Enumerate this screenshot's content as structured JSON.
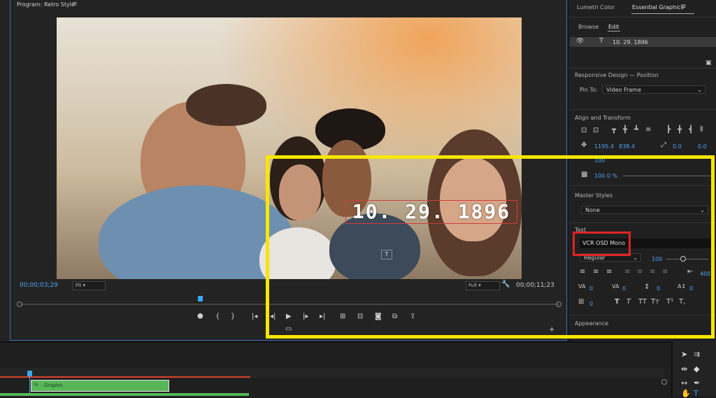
{
  "program": {
    "tab_title": "Program: Retro Style",
    "tab_menu_icon": "hamburger-menu-icon",
    "overlay_text": "10. 29. 1896",
    "timecode_current": "00;00;03;29",
    "zoom": "Fit",
    "resolution": "Full",
    "timecode_duration": "00;00;11;23",
    "playhead_position": 0.33
  },
  "right_panel": {
    "tabs": [
      "Lumetri Color",
      "Essential Graphics"
    ],
    "active_tab": "Essential Graphics",
    "tab_menu_icon": "hamburger-menu-icon",
    "subtabs": [
      "Browse",
      "Edit"
    ],
    "active_subtab": "Edit",
    "layer": {
      "name": "10. 29. 1896",
      "type_icon": "text-layer-icon",
      "visibility_icon": "eye-icon"
    },
    "responsive_design": {
      "title": "Responsive Design — Position",
      "pin_label": "Pin To:",
      "pin_value": "Video Frame"
    },
    "align_transform": {
      "title": "Align and Transform",
      "pos_x": "1195.4",
      "pos_y": "838.4",
      "rotation": "0.0",
      "anchor": "0.0",
      "scale_partial": "100",
      "opacity": "100.0 %"
    },
    "master_styles": {
      "title": "Master Styles",
      "value": "None"
    },
    "text": {
      "title": "Text",
      "font": "VCR OSD Mono",
      "style": "Regular",
      "size": "100",
      "tracking_value": "400",
      "kerning": "0",
      "tracking": "0",
      "leading": "0",
      "baseline": "0",
      "tsume": "0",
      "style_buttons": [
        "T",
        "T",
        "TT",
        "Tт",
        "T¹",
        "T,"
      ]
    },
    "appearance": {
      "title": "Appearance"
    }
  },
  "timeline": {
    "clip_label": "Graphic",
    "clip_icon": "fx-badge-icon"
  },
  "tools": [
    "selection-tool-icon",
    "track-select-icon",
    "ripple-edit-icon",
    "razor-tool-icon",
    "slip-tool-icon",
    "pen-tool-icon",
    "hand-tool-icon",
    "type-tool-icon"
  ],
  "colors": {
    "highlight_yellow": "#f7e600",
    "highlight_red": "#e02424",
    "accent_blue": "#4da3f0",
    "clip_green": "#58b659"
  }
}
